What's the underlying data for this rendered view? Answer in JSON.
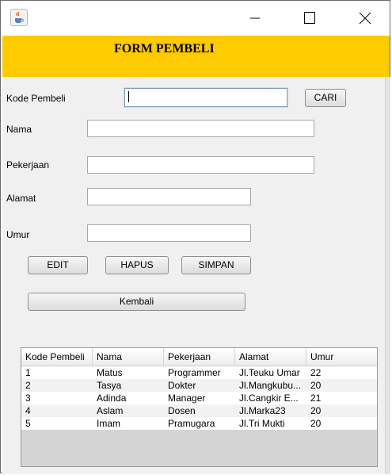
{
  "window": {
    "controls": {
      "minimize": "minimize-icon",
      "maximize": "maximize-icon",
      "close": "close-icon"
    },
    "app_icon": "java-cup-icon"
  },
  "header": {
    "title": "FORM PEMBELI",
    "background": "#fecb00"
  },
  "form": {
    "kode_label": "Kode Pembeli",
    "kode_value": "",
    "cari_label": "CARI",
    "nama_label": "Nama",
    "nama_value": "",
    "pekerjaan_label": "Pekerjaan",
    "pekerjaan_value": "",
    "alamat_label": "Alamat",
    "alamat_value": "",
    "umur_label": "Umur",
    "umur_value": ""
  },
  "buttons": {
    "edit": "EDIT",
    "hapus": "HAPUS",
    "simpan": "SIMPAN",
    "kembali": "Kembali"
  },
  "table": {
    "columns": [
      "Kode Pembeli",
      "Nama",
      "Pekerjaan",
      "Alamat",
      "Umur"
    ],
    "rows": [
      [
        "1",
        "Matus",
        "Programmer",
        "Jl.Teuku Umar",
        "22"
      ],
      [
        "2",
        "Tasya",
        "Dokter",
        "Jl.Mangkubu...",
        "20"
      ],
      [
        "3",
        "Adinda",
        "Manager",
        "Jl.Cangkir E...",
        "21"
      ],
      [
        "4",
        "Aslam",
        "Dosen",
        "Jl.Marka23",
        "20"
      ],
      [
        "5",
        "Imam",
        "Pramugara",
        "Jl.Tri Mukti",
        "20"
      ]
    ]
  }
}
